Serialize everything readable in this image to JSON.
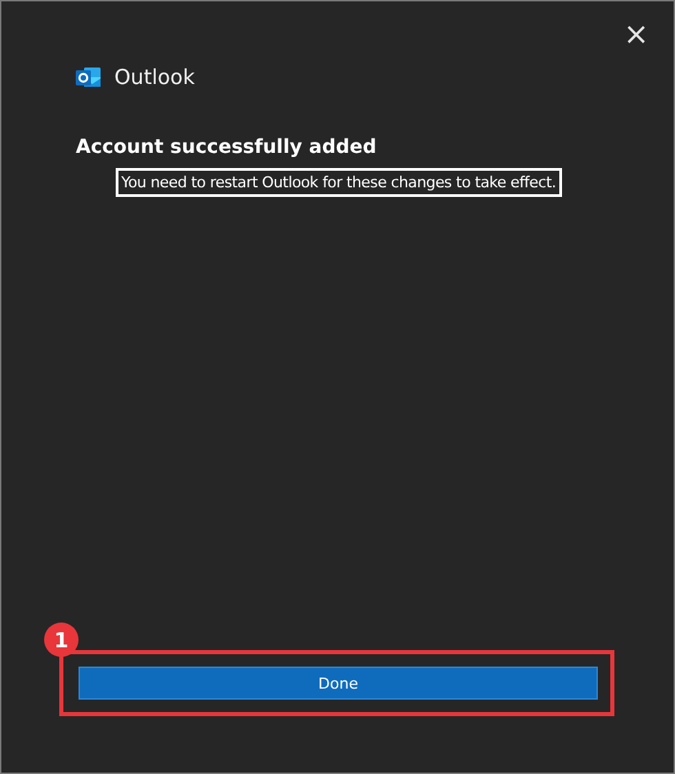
{
  "window": {
    "close_glyph": "×"
  },
  "app": {
    "name": "Outlook"
  },
  "heading": "Account successfully added",
  "message": {
    "text": "You need to restart Outlook for these changes to take effect.",
    "highlighted": true
  },
  "callout": {
    "number": "1",
    "highlighted": true
  },
  "buttons": [
    {
      "label": "Done",
      "kind": "primary"
    }
  ]
}
